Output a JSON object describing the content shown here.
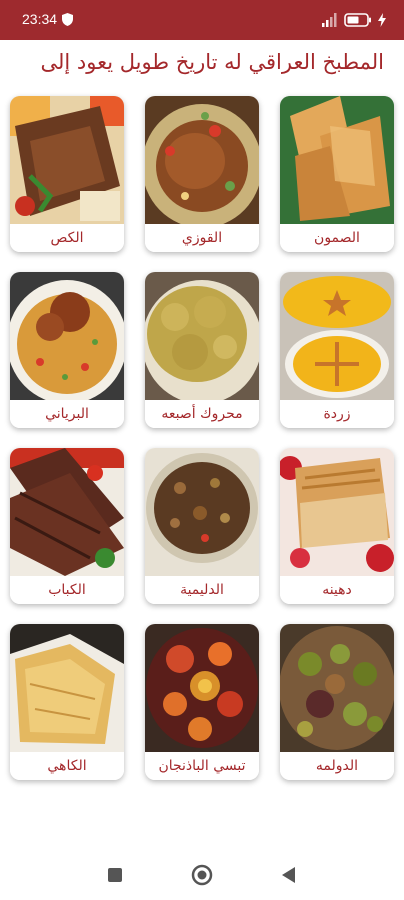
{
  "status_bar": {
    "time": "23:34",
    "icons": [
      "shield-icon",
      "signal-icon",
      "battery-icon",
      "charging-icon"
    ],
    "color": "#9e2a2e"
  },
  "header": {
    "title": "المطبخ العراقي له تاريخ طويل يعود إلى",
    "color": "#a4282b"
  },
  "dishes": [
    {
      "name": "الصمون"
    },
    {
      "name": "القوزي"
    },
    {
      "name": "الكص"
    },
    {
      "name": "زردة"
    },
    {
      "name": "محروك أصبعه"
    },
    {
      "name": "البرياني"
    },
    {
      "name": "دهينه"
    },
    {
      "name": "الدليمية"
    },
    {
      "name": "الكباب"
    },
    {
      "name": "الدولمه"
    },
    {
      "name": "تبسي الباذنجان"
    },
    {
      "name": "الكاهي"
    }
  ],
  "nav_bar": {
    "icons": [
      "square-icon",
      "home-circle-icon",
      "back-triangle-icon"
    ]
  }
}
